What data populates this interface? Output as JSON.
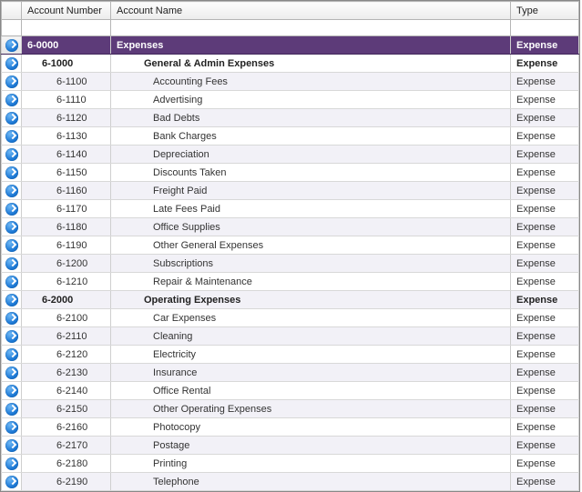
{
  "headers": {
    "accountNumber": "Account Number",
    "accountName": "Account Name",
    "type": "Type"
  },
  "rows": [
    {
      "number": "6-0000",
      "name": "Expenses",
      "type": "Expense",
      "level": 0,
      "bold": true,
      "selected": true
    },
    {
      "number": "6-1000",
      "name": "General & Admin Expenses",
      "type": "Expense",
      "level": 1,
      "bold": true
    },
    {
      "number": "6-1100",
      "name": "Accounting Fees",
      "type": "Expense",
      "level": 2
    },
    {
      "number": "6-1110",
      "name": "Advertising",
      "type": "Expense",
      "level": 2
    },
    {
      "number": "6-1120",
      "name": "Bad Debts",
      "type": "Expense",
      "level": 2
    },
    {
      "number": "6-1130",
      "name": "Bank Charges",
      "type": "Expense",
      "level": 2
    },
    {
      "number": "6-1140",
      "name": "Depreciation",
      "type": "Expense",
      "level": 2
    },
    {
      "number": "6-1150",
      "name": "Discounts Taken",
      "type": "Expense",
      "level": 2
    },
    {
      "number": "6-1160",
      "name": "Freight Paid",
      "type": "Expense",
      "level": 2
    },
    {
      "number": "6-1170",
      "name": "Late Fees Paid",
      "type": "Expense",
      "level": 2
    },
    {
      "number": "6-1180",
      "name": "Office Supplies",
      "type": "Expense",
      "level": 2
    },
    {
      "number": "6-1190",
      "name": "Other General Expenses",
      "type": "Expense",
      "level": 2
    },
    {
      "number": "6-1200",
      "name": "Subscriptions",
      "type": "Expense",
      "level": 2
    },
    {
      "number": "6-1210",
      "name": "Repair & Maintenance",
      "type": "Expense",
      "level": 2
    },
    {
      "number": "6-2000",
      "name": "Operating Expenses",
      "type": "Expense",
      "level": 1,
      "bold": true
    },
    {
      "number": "6-2100",
      "name": "Car Expenses",
      "type": "Expense",
      "level": 2
    },
    {
      "number": "6-2110",
      "name": "Cleaning",
      "type": "Expense",
      "level": 2
    },
    {
      "number": "6-2120",
      "name": "Electricity",
      "type": "Expense",
      "level": 2
    },
    {
      "number": "6-2130",
      "name": "Insurance",
      "type": "Expense",
      "level": 2
    },
    {
      "number": "6-2140",
      "name": "Office Rental",
      "type": "Expense",
      "level": 2
    },
    {
      "number": "6-2150",
      "name": "Other Operating Expenses",
      "type": "Expense",
      "level": 2
    },
    {
      "number": "6-2160",
      "name": "Photocopy",
      "type": "Expense",
      "level": 2
    },
    {
      "number": "6-2170",
      "name": "Postage",
      "type": "Expense",
      "level": 2
    },
    {
      "number": "6-2180",
      "name": "Printing",
      "type": "Expense",
      "level": 2
    },
    {
      "number": "6-2190",
      "name": "Telephone",
      "type": "Expense",
      "level": 2
    }
  ]
}
